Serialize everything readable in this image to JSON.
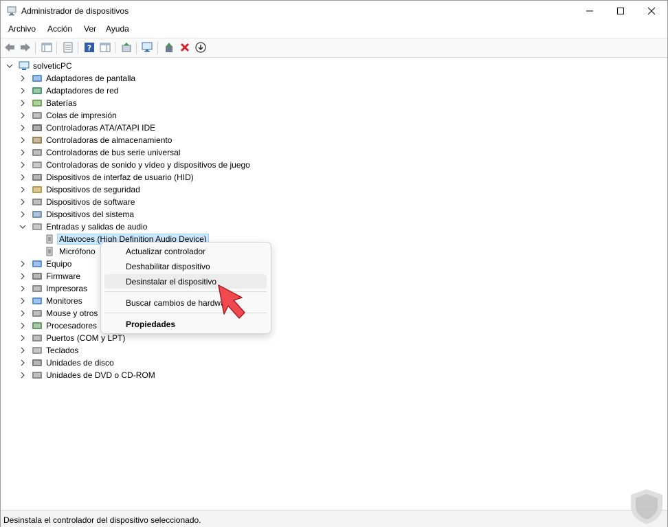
{
  "window": {
    "title": "Administrador de dispositivos"
  },
  "menu": [
    "Archivo",
    "Acción",
    "Ver",
    "Ayuda"
  ],
  "toolbar_icons": [
    "back-icon",
    "forward-icon",
    "show-hide-console-tree-icon",
    "properties-sheet-icon",
    "help-icon",
    "action-pane-icon",
    "update-driver-icon",
    "scan-hardware-icon",
    "enable-device-icon",
    "uninstall-device-icon",
    "disable-device-icon"
  ],
  "tree": {
    "root": "solveticPC",
    "categories": [
      "Adaptadores de pantalla",
      "Adaptadores de red",
      "Baterías",
      "Colas de impresión",
      "Controladoras ATA/ATAPI IDE",
      "Controladoras de almacenamiento",
      "Controladoras de bus serie universal",
      "Controladoras de sonido y vídeo y dispositivos de juego",
      "Dispositivos de interfaz de usuario (HID)",
      "Dispositivos de seguridad",
      "Dispositivos de software",
      "Dispositivos del sistema",
      "Entradas y salidas de audio",
      "Equipo",
      "Firmware",
      "Impresoras",
      "Monitores",
      "Mouse y otros",
      "Procesadores",
      "Puertos (COM y LPT)",
      "Teclados",
      "Unidades de disco",
      "Unidades de DVD o CD-ROM"
    ],
    "audio_children": [
      "Altavoces (High Definition Audio Device)",
      "Micrófono"
    ]
  },
  "context_menu": {
    "update": "Actualizar controlador",
    "disable": "Deshabilitar dispositivo",
    "uninstall": "Desinstalar el dispositivo",
    "scan": "Buscar cambios de hardware",
    "properties": "Propiedades"
  },
  "status": "Desinstala el controlador del dispositivo seleccionado.",
  "colors": {
    "selection": "#cce8ff",
    "accent_red": "#e8323c",
    "arrow_red": "#f04a50"
  }
}
